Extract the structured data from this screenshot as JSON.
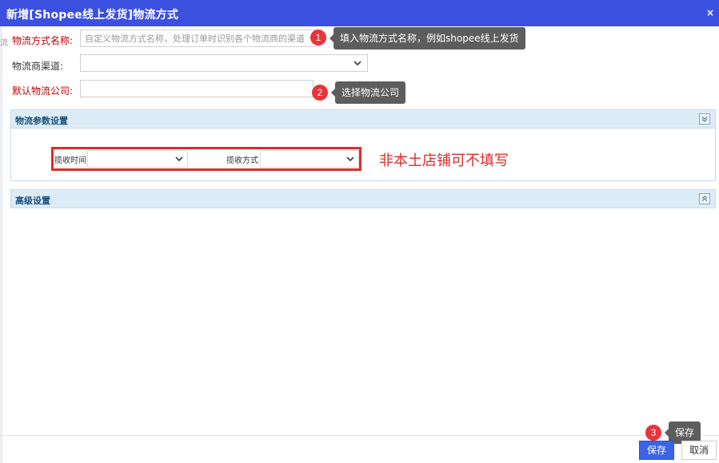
{
  "dialog": {
    "title": "新增[Shopee线上发货]物流方式",
    "close_label": "×"
  },
  "left_edge_char": "流",
  "form": {
    "name": {
      "label": "物流方式名称:",
      "placeholder": "自定义物流方式名称，处理订单时识别各个物流商的渠道"
    },
    "carrier_channel": {
      "label": "物流商渠道:",
      "value": ""
    },
    "default_company": {
      "label": "默认物流公司:",
      "value": ""
    }
  },
  "markers": [
    {
      "number": "1",
      "tip": "填入物流方式名称，例如shopee线上发货"
    },
    {
      "number": "2",
      "tip": "选择物流公司"
    },
    {
      "number": "3",
      "tip": "保存"
    }
  ],
  "sections": {
    "logistics_params": {
      "title": "物流参数设置",
      "pickup_time_label": "揽收时间",
      "pickup_time_value": "",
      "pickup_method_label": "揽收方式",
      "pickup_method_value": ""
    },
    "advanced": {
      "title": "高级设置"
    }
  },
  "annotation": "非本土店铺可不填写",
  "footer": {
    "save_label": "保存",
    "cancel_label": "取消"
  },
  "colors": {
    "titlebar": "#3c50df",
    "required_label": "#c00000",
    "marker": "#e8343a",
    "tooltip": "#5d5d5d",
    "highlight": "#e02b2b",
    "section_header": "#dcecf6",
    "save_button": "#3c64e6"
  }
}
